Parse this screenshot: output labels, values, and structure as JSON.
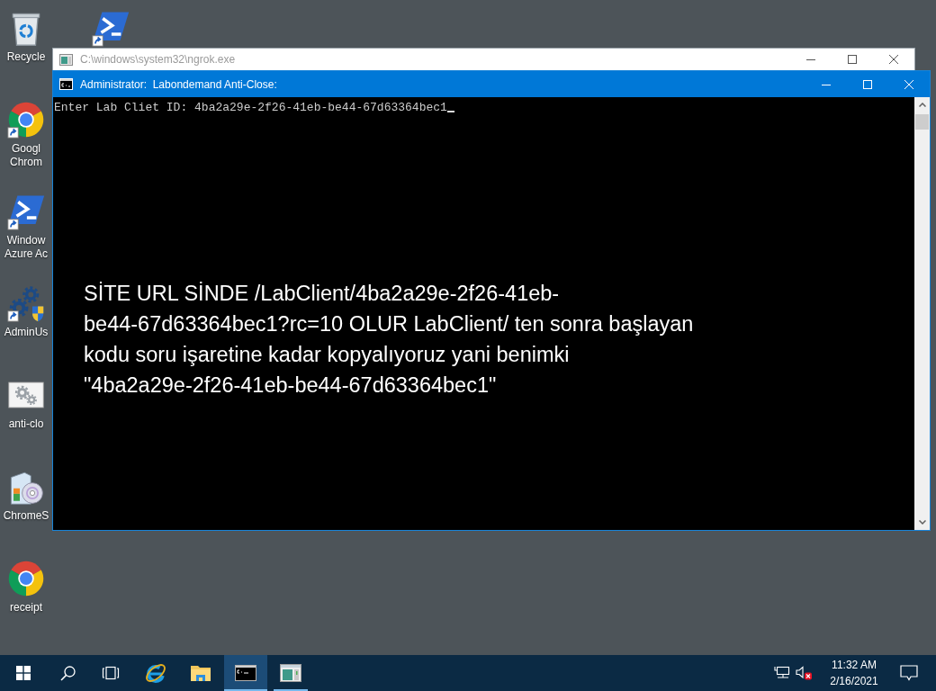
{
  "desktop_icons": [
    {
      "kind": "recycle-bin",
      "label": "Recycle",
      "shortcut": false
    },
    {
      "kind": "browser",
      "label": "Googl Chrom",
      "shortcut": true
    },
    {
      "kind": "terminal",
      "label": "Window Azure Ac",
      "shortcut": true
    },
    {
      "kind": "gears-shield",
      "label": "AdminUs",
      "shortcut": true
    },
    {
      "kind": "gears-file",
      "label": "anti-clo",
      "shortcut": false
    },
    {
      "kind": "software-box",
      "label": "ChromeS",
      "shortcut": false
    },
    {
      "kind": "browser",
      "label": "receipt",
      "shortcut": false
    },
    {
      "kind": "terminal",
      "shortcut": true
    }
  ],
  "windows": [
    {
      "kind": "app",
      "title": "C:\\windows\\system32\\ngrok.exe",
      "active": false
    },
    {
      "kind": "console",
      "title": "Administrator:  Labondemand Anti-Close:",
      "active": true,
      "console_lines": [
        "Enter Lab Cliet ID: 4ba2a29e-2f26-41eb-be44-67d63364bec1"
      ],
      "cursor_visible": true,
      "annotation": "SİTE URL SİNDE /LabClient/4ba2a29e-2f26-41eb-\nbe44-67d63364bec1?rc=10 OLUR LabClient/ ten sonra başlayan\nkodu soru işaretine kadar kopyalıyoruz yani benimki\n\"4ba2a29e-2f26-41eb-be44-67d63364bec1\""
    }
  ],
  "taskbar": {
    "apps": [
      {
        "kind": "browser",
        "running": false,
        "selected": false
      },
      {
        "kind": "folder",
        "running": false,
        "selected": false
      },
      {
        "kind": "console",
        "running": true,
        "selected": true
      },
      {
        "kind": "window",
        "running": true,
        "selected": false
      }
    ],
    "tray": {
      "volume_muted": true,
      "time": "11:32 AM",
      "date": "2/16/2021"
    }
  }
}
